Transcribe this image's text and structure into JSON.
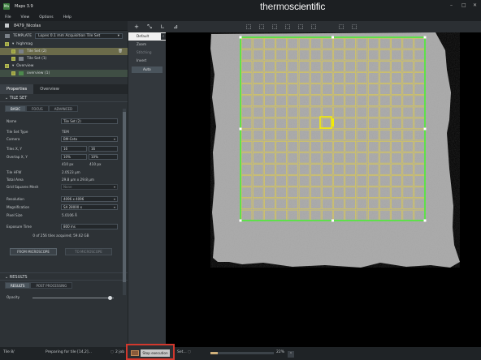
{
  "app": {
    "title": "Maps 3.9",
    "icon_label": "Ma",
    "brand_main": "thermo",
    "brand_second": "scientific"
  },
  "menu": [
    "File",
    "View",
    "Options",
    "Help"
  ],
  "project": {
    "name": "8479_Nicolas",
    "template_label": "TEMPLATE",
    "template_value": "Lopes 0.1 mm Acquisition Tile Set"
  },
  "tree": [
    {
      "label": "highmag"
    },
    {
      "label": "Tile Set (2)"
    },
    {
      "label": "Tile Set (1)"
    },
    {
      "label": "Overview"
    },
    {
      "label": "overview (1)"
    }
  ],
  "panel_tabs": [
    "Properties",
    "Overview"
  ],
  "tile_set": {
    "section_title": "TILE SET",
    "subtabs": [
      "BASIC",
      "FOCUS",
      "ADVANCED"
    ],
    "name_label": "Name",
    "name_value": "Tile Set (2)",
    "tile_type_label": "Tile Set Type",
    "tile_type_value": "TEM",
    "camera_label": "Camera",
    "camera_value": "BM-Ceta",
    "tiles_label": "Tiles X, Y",
    "tiles_x": "16",
    "tiles_y": "16",
    "overlap_label": "Overlap X, Y",
    "overlap_x": "10%",
    "overlap_y": "10%",
    "px_x": "410 px",
    "px_y": "410 px",
    "hfw_label": "Tile HFW",
    "hfw_value": "2.0523 µm",
    "area_label": "Total Area",
    "area_value": "29.8 µm x 29.8 µm",
    "grid_mesh_label": "Grid Squares Mesh",
    "grid_mesh_value": "None",
    "resolution_label": "Resolution",
    "resolution_value": "4096 x 4096",
    "magnification_label": "Magnification",
    "magnification_value": "SA 28000 x",
    "pixel_size_label": "Pixel Size",
    "pixel_size_value": "5.0106 Å",
    "exposure_label": "Exposure Time",
    "exposure_value": "800 ms",
    "tiles_acquired": "0 of 256 tiles acquired; 59.62 GB",
    "from_microscope": "FROM MICROSCOPE",
    "to_microscope": "TO MICROSCOPE"
  },
  "results": {
    "section_title": "RESULTS",
    "subtabs": [
      "RESULTS",
      "POST PROCESSING"
    ],
    "opacity_label": "Opacity",
    "opacity": 0.95
  },
  "layers": {
    "items": [
      "Default",
      "Zoom",
      "Stitching",
      "Invert"
    ],
    "auto_label": "Auto"
  },
  "tools": [
    "+",
    "⤡",
    "∟",
    "⊿",
    "⬚",
    "⬚",
    "⬚",
    "⬚",
    "⬚",
    "⬚",
    "⬚",
    "⬚"
  ],
  "status": {
    "left_label": "Tile 8/",
    "preparing": "Preparing for tile [14,2]...",
    "jobs": "2 job",
    "stop_label": "Stop execution",
    "set_label": "Set...",
    "zoom_text": "22%",
    "progress": 0.12
  },
  "colors": {
    "grid_green": "#5ee04a",
    "tile_yellow": "#e8d23a",
    "current_tile": "#f5ee00",
    "stop_border": "#d2382d"
  }
}
